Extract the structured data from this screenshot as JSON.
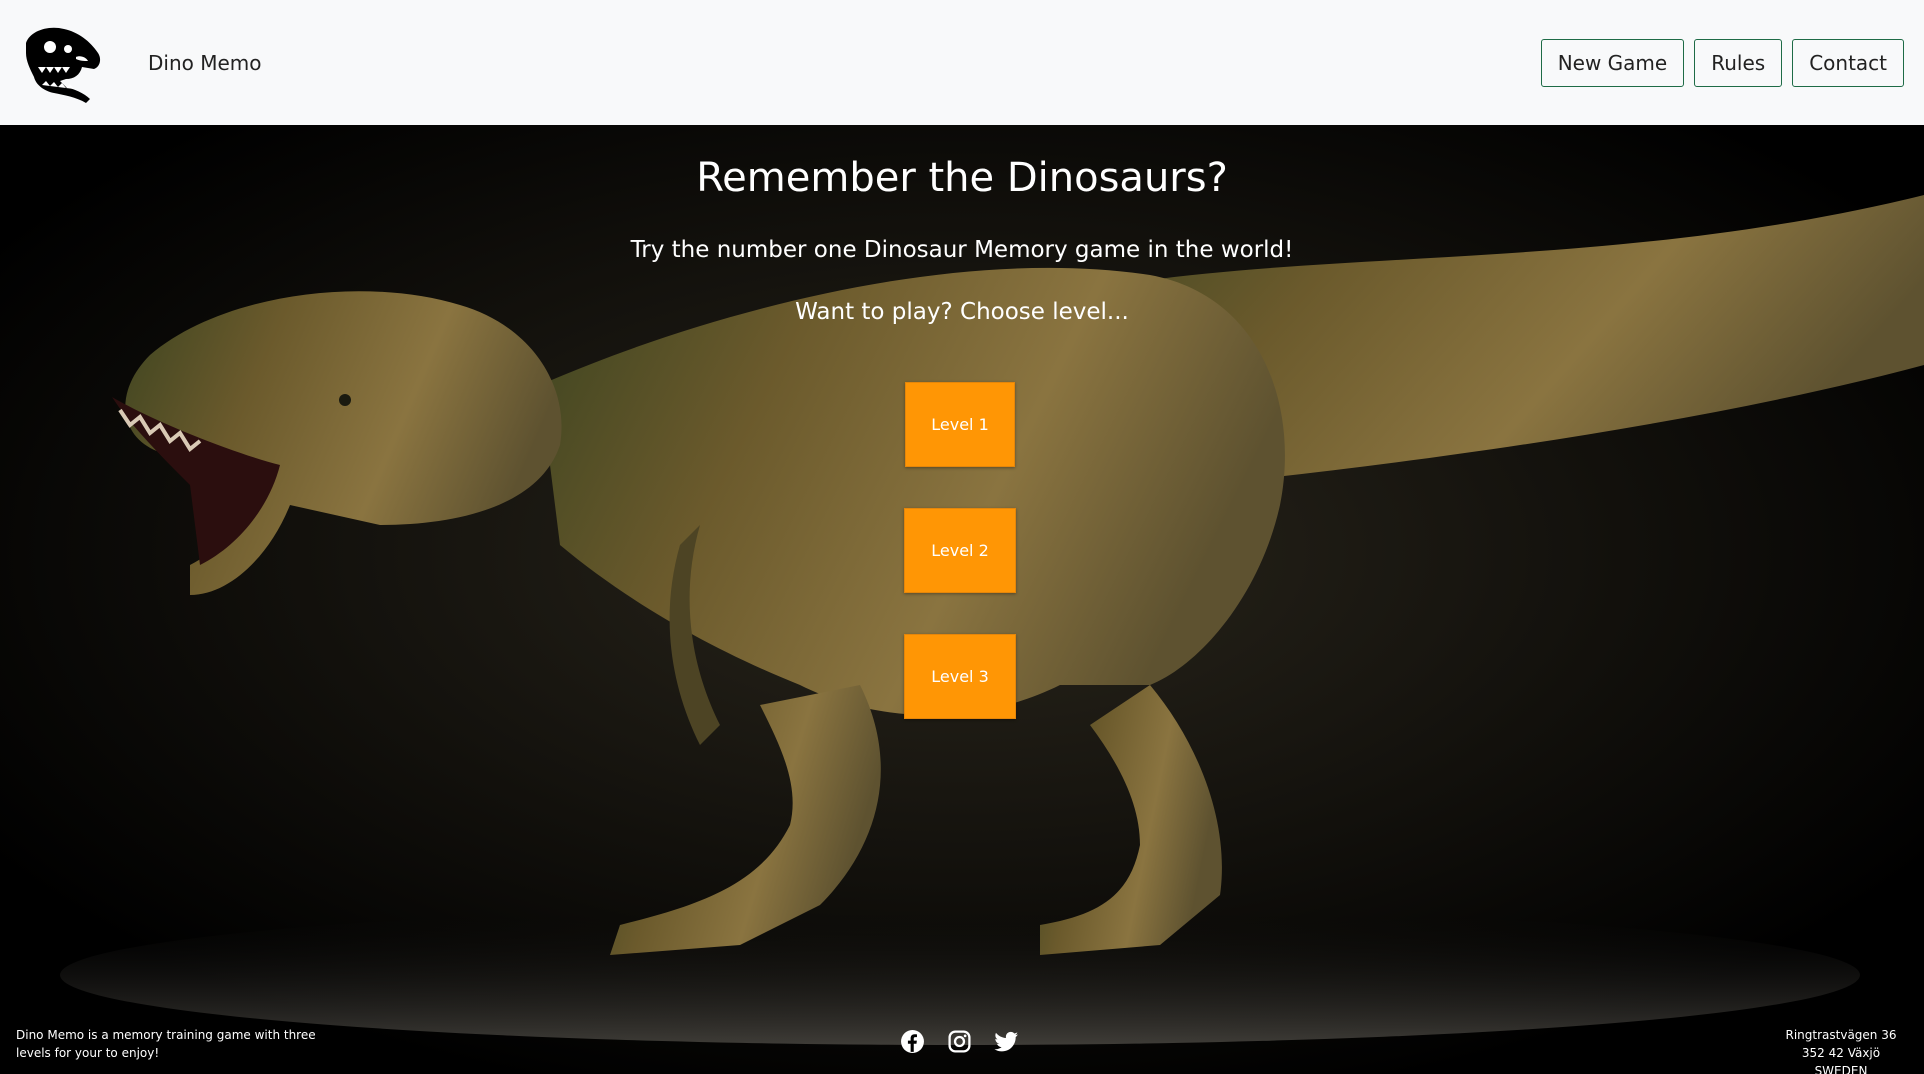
{
  "header": {
    "brand_name": "Dino Memo",
    "logo_icon": "dinosaur-skull-icon",
    "nav": {
      "new_game": "New Game",
      "rules": "Rules",
      "contact": "Contact"
    }
  },
  "hero": {
    "title": "Remember the Dinosaurs?",
    "tagline": "Try the number one Dinosaur Memory game in the world!",
    "prompt": "Want to play? Choose level...",
    "levels": {
      "level1": "Level 1",
      "level2": "Level 2",
      "level3": "Level 3"
    }
  },
  "footer": {
    "about": "Dino Memo is a memory training game with three levels for your to enjoy!",
    "social_icons": [
      "facebook-icon",
      "instagram-icon",
      "twitter-icon"
    ],
    "address": {
      "street": "Ringtrastvägen 36",
      "city": "352 42 Växjö",
      "country": "SWEDEN"
    }
  },
  "colors": {
    "navbar_bg": "#f8f9fa",
    "nav_border": "#1e6b46",
    "level_button": "#ff9605",
    "hero_bg": "#000000"
  }
}
